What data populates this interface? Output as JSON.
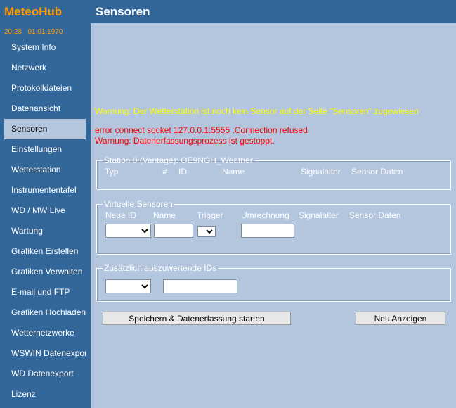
{
  "app": {
    "name": "MeteoHub",
    "time": "20:28",
    "date": "01.01.1970"
  },
  "nav": {
    "items": [
      "System Info",
      "Netzwerk",
      "Protokolldateien",
      "Datenansicht",
      "Sensoren",
      "Einstellungen",
      "Wetterstation",
      "Instrumententafel",
      "WD / MW Live",
      "Wartung",
      "Grafiken Erstellen",
      "Grafiken Verwalten",
      "E-mail und FTP",
      "Grafiken Hochladen",
      "Wetternetzwerke",
      "WSWIN Datenexport",
      "WD Datenexport",
      "Lizenz"
    ],
    "active_index": 4
  },
  "header": {
    "title": "Sensoren"
  },
  "messages": {
    "warning_no_sensor": "Warnung: Der Wetterstation ist noch kein Sensor auf der Seite \"Sensoren\" zugewiesen",
    "error_socket": "error connect socket 127.0.0.1:5555 :Connection refused",
    "warning_stopped": "Warnung: Datenerfassungsprozess ist gestoppt."
  },
  "station": {
    "legend": "Station 0 (Vantage): OE9NGH_Weather",
    "columns": {
      "typ": "Typ",
      "num": "#",
      "id": "ID",
      "name": "Name",
      "signal": "Signalalter",
      "data": "Sensor Daten"
    }
  },
  "virtual": {
    "legend": "Virtuelle Sensoren",
    "columns": {
      "new_id": "Neue ID",
      "name": "Name",
      "trigger": "Trigger",
      "conversion": "Umrechnung",
      "signal": "Signalalter",
      "data": "Sensor Daten"
    },
    "new_id_value": "",
    "name_value": "",
    "trigger_value": "",
    "conversion_value": ""
  },
  "extra": {
    "legend": "Zusätzlich auszuwertende IDs",
    "id_value": "",
    "text_value": ""
  },
  "buttons": {
    "save": "Speichern & Datenerfassung starten",
    "refresh": "Neu Anzeigen"
  },
  "colors": {
    "sidebar": "#336699",
    "background": "#b3c6dd",
    "logo": "#ff9900",
    "warning": "#ffff00",
    "error": "#ff0000"
  }
}
